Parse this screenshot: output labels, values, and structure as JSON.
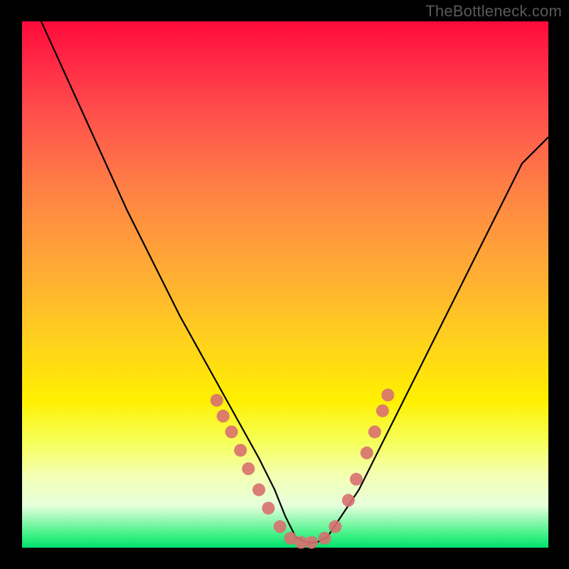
{
  "watermark": "TheBottleneck.com",
  "colors": {
    "frame": "#000000",
    "curve_stroke": "#000000",
    "marker_fill": "#d87070",
    "marker_stroke": "#d87070",
    "gradient_stops": [
      "#ff0a3b",
      "#ff2a45",
      "#ff4a4c",
      "#ff6a4a",
      "#ff8a42",
      "#ffab35",
      "#ffcf1e",
      "#fff000",
      "#f6ff5a",
      "#f4ffb0",
      "#e6ffdc",
      "#33f07f",
      "#00e070"
    ]
  },
  "chart_data": {
    "type": "line",
    "title": "",
    "xlabel": "",
    "ylabel": "",
    "xlim": [
      0,
      100
    ],
    "ylim": [
      0,
      100
    ],
    "x": [
      0,
      5,
      10,
      15,
      20,
      25,
      30,
      35,
      40,
      45,
      48,
      50,
      52,
      54,
      56,
      58,
      60,
      64,
      68,
      72,
      76,
      80,
      85,
      90,
      95,
      100
    ],
    "values": [
      108,
      97,
      86,
      75,
      64,
      54,
      44,
      35,
      26,
      17,
      11,
      6,
      2,
      1,
      1,
      2,
      5,
      11,
      19,
      27,
      35,
      43,
      53,
      63,
      73,
      78
    ],
    "markers": [
      {
        "x": 37.0,
        "y": 28.0
      },
      {
        "x": 38.2,
        "y": 25.0
      },
      {
        "x": 39.8,
        "y": 22.0
      },
      {
        "x": 41.5,
        "y": 18.5
      },
      {
        "x": 43.0,
        "y": 15.0
      },
      {
        "x": 45.0,
        "y": 11.0
      },
      {
        "x": 46.8,
        "y": 7.5
      },
      {
        "x": 49.0,
        "y": 4.0
      },
      {
        "x": 51.0,
        "y": 1.8
      },
      {
        "x": 53.0,
        "y": 1.0
      },
      {
        "x": 55.0,
        "y": 1.0
      },
      {
        "x": 57.5,
        "y": 1.8
      },
      {
        "x": 59.5,
        "y": 4.0
      },
      {
        "x": 62.0,
        "y": 9.0
      },
      {
        "x": 63.5,
        "y": 13.0
      },
      {
        "x": 65.5,
        "y": 18.0
      },
      {
        "x": 67.0,
        "y": 22.0
      },
      {
        "x": 68.5,
        "y": 26.0
      },
      {
        "x": 69.5,
        "y": 29.0
      }
    ],
    "annotations": []
  }
}
